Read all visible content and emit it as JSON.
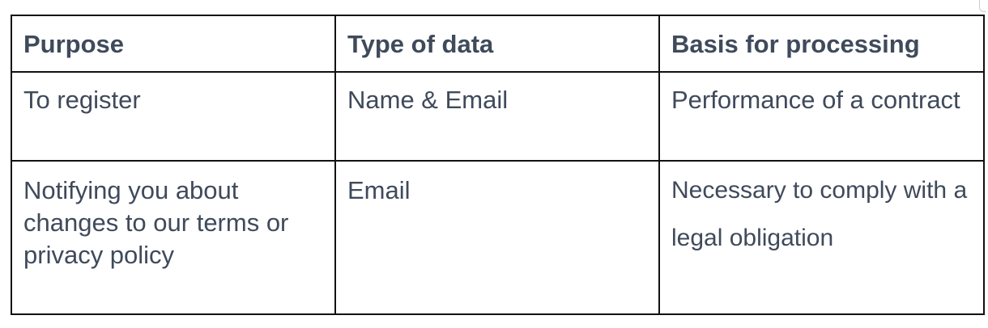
{
  "table": {
    "headers": [
      "Purpose",
      "Type of data",
      "Basis for processing"
    ],
    "rows": [
      [
        "To register",
        "Name & Email",
        "Performance of a contract"
      ],
      [
        "Notifying you about changes to our terms or privacy policy",
        "Email",
        "Necessary to comply with a legal obligation"
      ]
    ]
  }
}
